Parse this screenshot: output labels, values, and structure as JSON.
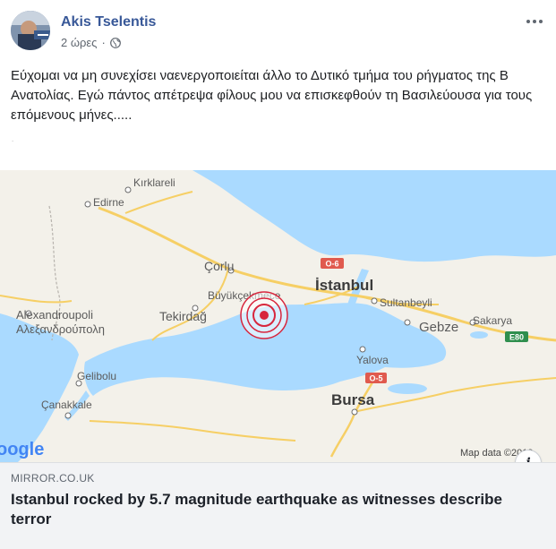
{
  "post": {
    "author": "Akis Tselentis",
    "time": "2 ώρες",
    "privacy_icon": "globe-icon",
    "menu_icon": "more-horizontal-icon",
    "text": "Εύχομαι να μη συνεχίσει ναενεργοποιείται άλλο το Δυτικό τμήμα του ρήγματος της Β Ανατολίας. Εγώ πάντος απέτρεψα φίλους μου να επισκεφθούν τη Βασιλεύουσα για τους επόμενους μήνες.....",
    "tiny_mark": "."
  },
  "link_preview": {
    "domain": "MIRROR.CO.UK",
    "headline": "Istanbul rocked by 5.7 magnitude earthquake as witnesses describe terror",
    "info_label": "i",
    "map": {
      "labels": {
        "kirklareli": "Kırklareli",
        "edirne": "Edirne",
        "corlu": "Çorlu",
        "istanbul": "İstanbul",
        "buyukcekmece": "Büyükçekmece",
        "tekirdag": "Tekirdağ",
        "alexandroupoli": "Alexandroupoli",
        "alexandroupoli_gr": "Αλεξανδρούπολη",
        "sultanbeyli": "Sultanbeyli",
        "gebze": "Gebze",
        "sakarya": "Sakarya",
        "yalova": "Yalova",
        "gelibolu": "Gelibolu",
        "canakkale": "Çanakkale",
        "bursa": "Bursa",
        "google": "oogle",
        "map_data": "Map data ©2019"
      },
      "road_badges": {
        "o6": "O-6",
        "o5": "O-5",
        "e80": "E80"
      },
      "colors": {
        "land": "#f3f1ea",
        "water": "#aadaff",
        "road": "#f6cf65",
        "epicenter": "#d7263d"
      }
    }
  }
}
